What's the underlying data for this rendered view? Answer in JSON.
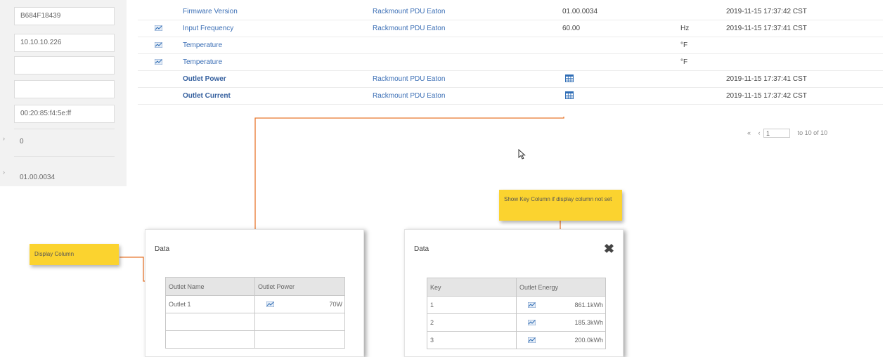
{
  "left_panel": {
    "fields": [
      "B684F18439",
      "10.10.10.226",
      "",
      "",
      "00:20:85:f4:5e:ff"
    ],
    "plain_values": [
      "0",
      "01.00.0034"
    ]
  },
  "table": {
    "rows": [
      {
        "icon": "",
        "name": "Firmware Version",
        "bold": false,
        "device": "Rackmount PDU Eaton",
        "value": "01.00.0034",
        "unit": "",
        "time": "2019-11-15 17:37:42 CST"
      },
      {
        "icon": "chart-icon",
        "name": "Input Frequency",
        "bold": false,
        "device": "Rackmount PDU Eaton",
        "value": "60.00",
        "unit": "Hz",
        "time": "2019-11-15 17:37:41 CST"
      },
      {
        "icon": "chart-icon",
        "name": "Temperature",
        "bold": false,
        "device": "",
        "value": "",
        "unit": "°F",
        "time": ""
      },
      {
        "icon": "chart-icon",
        "name": "Temperature",
        "bold": false,
        "device": "",
        "value": "",
        "unit": "°F",
        "time": ""
      },
      {
        "icon": "",
        "name": "Outlet Power",
        "bold": true,
        "device": "Rackmount PDU Eaton",
        "value": "grid-icon",
        "unit": "",
        "time": "2019-11-15 17:37:41 CST"
      },
      {
        "icon": "",
        "name": "Outlet Current",
        "bold": true,
        "device": "Rackmount PDU Eaton",
        "value": "grid-icon",
        "unit": "",
        "time": "2019-11-15 17:37:42 CST"
      }
    ]
  },
  "pager": {
    "first": "«",
    "prev": "‹",
    "page": "1",
    "summary": "to 10 of 10"
  },
  "callouts": {
    "display_column": "Display Column",
    "key_column": "Show Key Column if display column not set"
  },
  "dialog_left": {
    "title": "Data",
    "headers": [
      "Outlet Name",
      "Outlet Power"
    ],
    "rows": [
      {
        "name": "Outlet 1",
        "value": "70W"
      },
      {
        "name": "",
        "value": ""
      },
      {
        "name": "",
        "value": ""
      }
    ]
  },
  "dialog_right": {
    "title": "Data",
    "close": "✖",
    "headers": [
      "Key",
      "Outlet Energy"
    ],
    "rows": [
      {
        "key": "1",
        "value": "861.1kWh"
      },
      {
        "key": "2",
        "value": "185.3kWh"
      },
      {
        "key": "3",
        "value": "200.0kWh"
      }
    ]
  },
  "colors": {
    "link": "#3a6eb5",
    "callout": "#fbd32f",
    "connector": "#e8772e",
    "header_bg": "#e5e5e5"
  }
}
